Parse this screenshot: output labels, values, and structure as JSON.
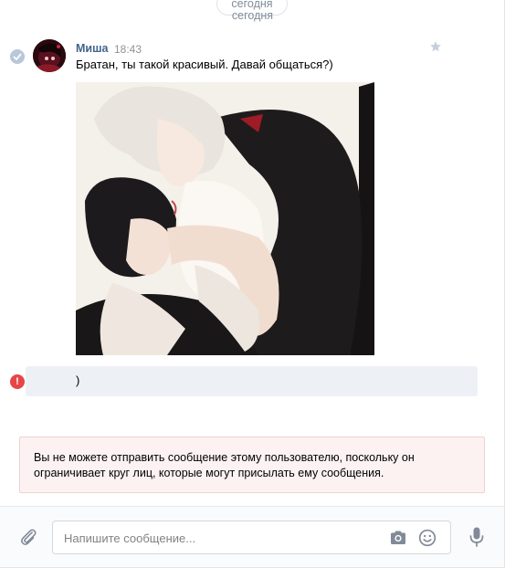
{
  "date_separator": {
    "label": "сегодня",
    "ghost_label": "сегодня"
  },
  "message": {
    "author": "Миша",
    "time": "18:43",
    "text": "Братан, ты такой красивый. Давай общаться?)",
    "read_icon": "check-circle-icon",
    "star_icon": "star-icon",
    "photo_icon": "anime-illustration-photo"
  },
  "failed_message": {
    "text": ")",
    "error_icon": "error-icon",
    "error_glyph": "!"
  },
  "notice": {
    "text": "Вы не можете отправить сообщение этому пользователю, поскольку он ограничивает круг лиц, которые могут присылать ему сообщения."
  },
  "composer": {
    "placeholder": "Напишите сообщение...",
    "attach_icon": "paperclip-icon",
    "camera_icon": "camera-icon",
    "emoji_icon": "smile-icon",
    "mic_icon": "microphone-icon"
  },
  "colors": {
    "link": "#42648b",
    "muted": "#939393",
    "error": "#e64646",
    "notice_bg": "#fdf2f2",
    "bubble_bg": "#edf0f5",
    "icon": "#828a99"
  }
}
